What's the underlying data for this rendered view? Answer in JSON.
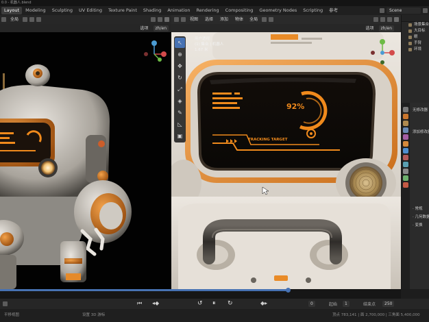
{
  "window": {
    "title": "0.0 - 机器人.blend"
  },
  "menubar": {
    "tabs": [
      "Layout",
      "Modeling",
      "Sculpting",
      "UV Editing",
      "Texture Paint",
      "Shading",
      "Animation",
      "Rendering",
      "Compositing",
      "Geometry Nodes",
      "Scripting",
      "参考"
    ],
    "active_tab": "Layout",
    "scene": "Scene"
  },
  "left_viewport": {
    "transform_orientation": "全局",
    "options_label": "选项",
    "axis_label": "zh/en"
  },
  "right_viewport": {
    "menu": [
      "视图",
      "选择",
      "添加",
      "物体"
    ],
    "transform_orientation": "全局",
    "options_label": "选项",
    "axis_label": "zh/en",
    "overlay_lines": [
      "用户透视",
      "(1) 集合 | 机器人",
      "1.67 米"
    ],
    "tools": [
      "select-box",
      "cursor",
      "move",
      "rotate",
      "scale",
      "transform",
      "annotate",
      "measure",
      "add-cube"
    ],
    "screen_ui": {
      "percent": "92%",
      "label": "TRACKING TARGET"
    }
  },
  "outliner": {
    "rows": [
      "场景集合",
      "大目标",
      "眼",
      "手臂",
      "环境"
    ]
  },
  "properties": {
    "rows": [
      "无修改器",
      "添加修改器",
      "· 常规",
      "· 几何数据",
      "· 变换"
    ]
  },
  "playback": {
    "current_frame": "0",
    "start_label": "起始",
    "start_value": "1",
    "end_label": "结束点",
    "end_value": "250"
  },
  "status": {
    "left": "平移视图",
    "middle": "设置 3D 游标",
    "right": "顶点 783,141 | 面 2,700,000 | 三角面 5,400,000"
  },
  "colors": {
    "accent": "#4772b3",
    "screen_orange": "#f08a1c",
    "body_white": "#d9d3ca",
    "orange_trim": "#e8902e"
  }
}
